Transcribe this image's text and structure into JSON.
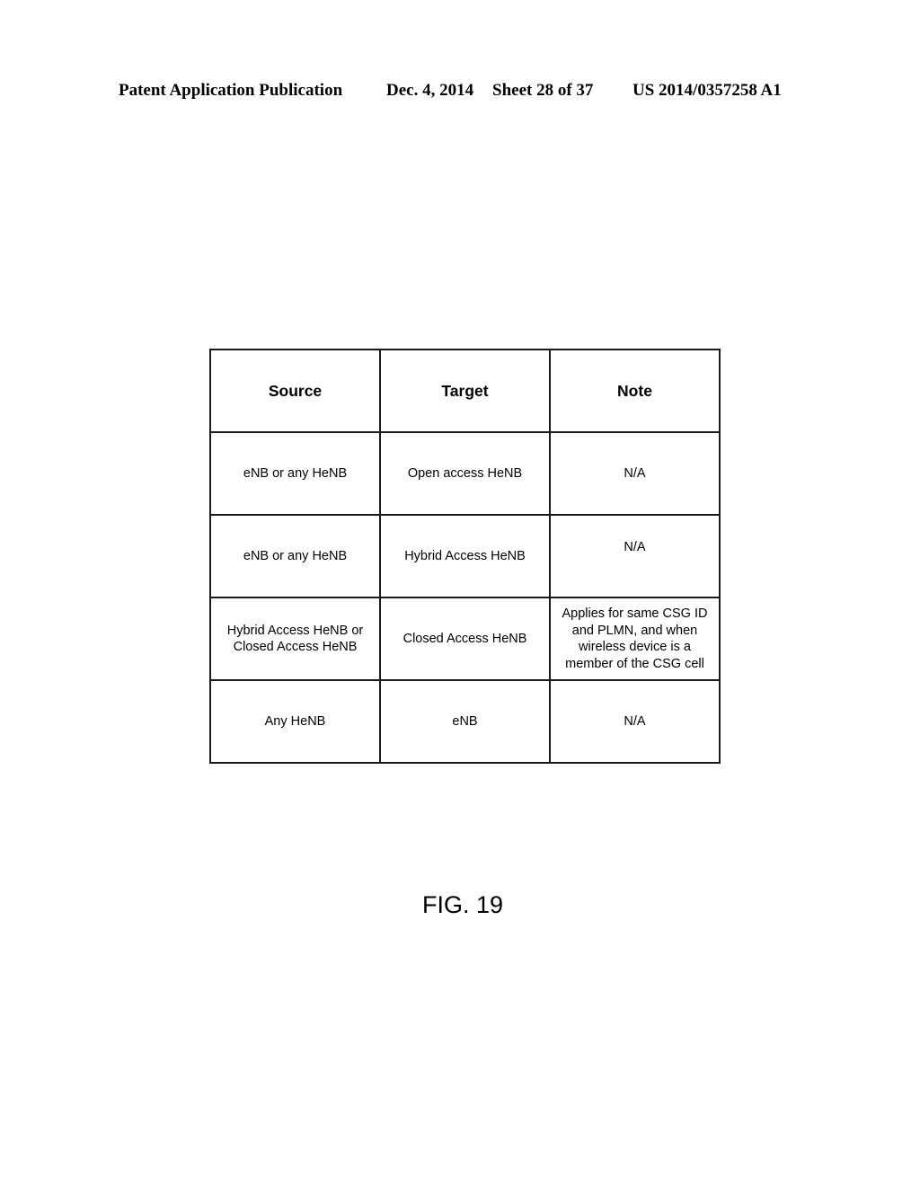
{
  "header": {
    "publication": "Patent Application Publication",
    "date": "Dec. 4, 2014",
    "sheet": "Sheet 28 of 37",
    "number": "US 2014/0357258 A1"
  },
  "table": {
    "columns": [
      "Source",
      "Target",
      "Note"
    ],
    "rows": [
      [
        "eNB or any HeNB",
        "Open access HeNB",
        "N/A"
      ],
      [
        "eNB or any HeNB",
        "Hybrid Access HeNB",
        "N/A"
      ],
      [
        "Hybrid Access HeNB or Closed Access HeNB",
        "Closed Access HeNB",
        "Applies for same CSG ID and PLMN, and when wireless device is a member of the CSG cell"
      ],
      [
        "Any HeNB",
        "eNB",
        "N/A"
      ]
    ]
  },
  "figure": {
    "label": "FIG. 19"
  }
}
